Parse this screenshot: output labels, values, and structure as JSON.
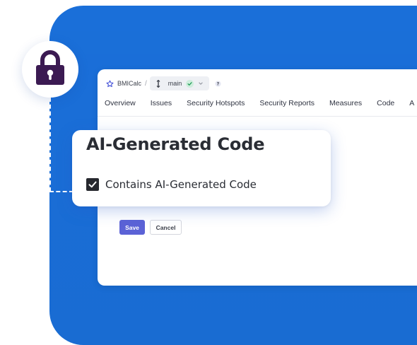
{
  "topbar": {
    "project_name": "BMICalc",
    "breadcrumb_separator": "/",
    "branch_name": "main",
    "icons": [
      "star-icon",
      "branch-icon",
      "check-icon",
      "chevron-down-icon",
      "help-icon"
    ]
  },
  "nav": {
    "items": [
      "Overview",
      "Issues",
      "Security Hotspots",
      "Security Reports",
      "Measures",
      "Code",
      "A"
    ]
  },
  "form": {
    "save_label": "Save",
    "cancel_label": "Cancel"
  },
  "callout": {
    "title": "AI-Generated Code",
    "checkbox_label": "Contains AI-Generated Code",
    "checkbox_checked": true
  },
  "badge": {
    "icon": "lock-icon"
  },
  "colors": {
    "background_blue": "#1a6fd9",
    "lock_purple": "#3b1a52",
    "save_button": "#5b62d6"
  }
}
